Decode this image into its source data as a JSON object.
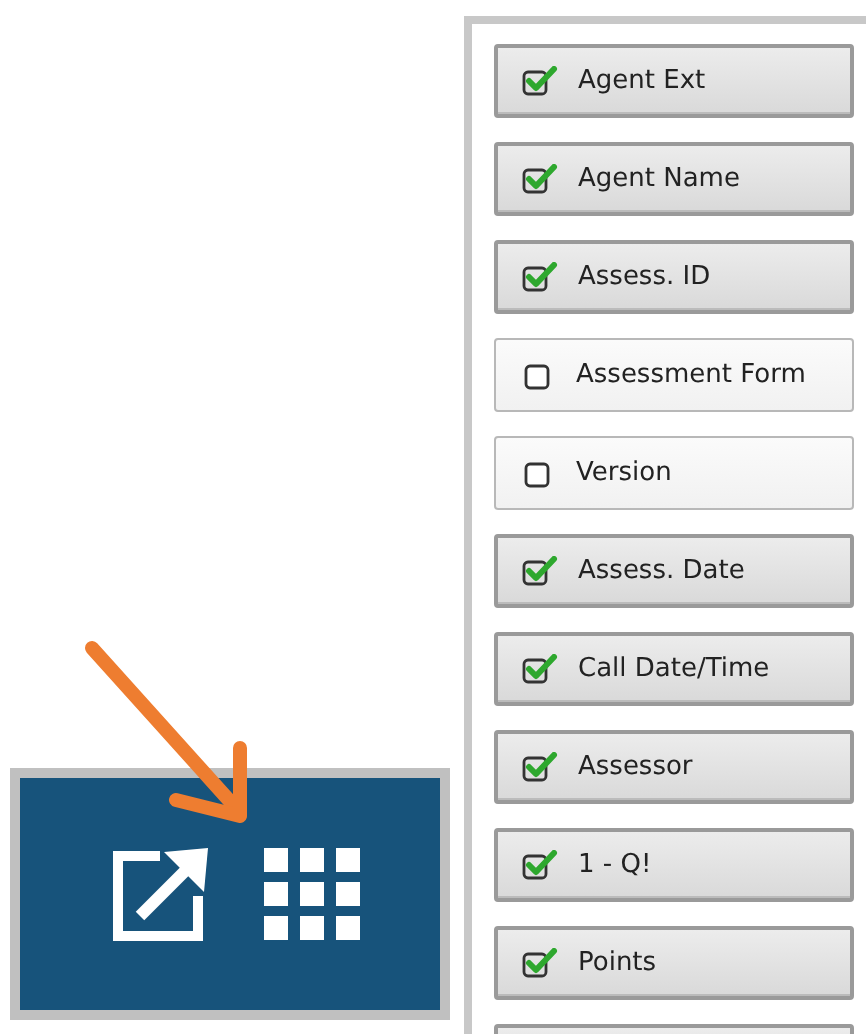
{
  "columns": [
    {
      "label": "Agent Ext",
      "checked": true
    },
    {
      "label": "Agent Name",
      "checked": true
    },
    {
      "label": "Assess. ID",
      "checked": true
    },
    {
      "label": "Assessment Form",
      "checked": false
    },
    {
      "label": "Version",
      "checked": false
    },
    {
      "label": "Assess. Date",
      "checked": true
    },
    {
      "label": "Call Date/Time",
      "checked": true
    },
    {
      "label": "Assessor",
      "checked": true
    },
    {
      "label": "1 - Q!",
      "checked": true
    },
    {
      "label": "Points",
      "checked": true
    }
  ]
}
